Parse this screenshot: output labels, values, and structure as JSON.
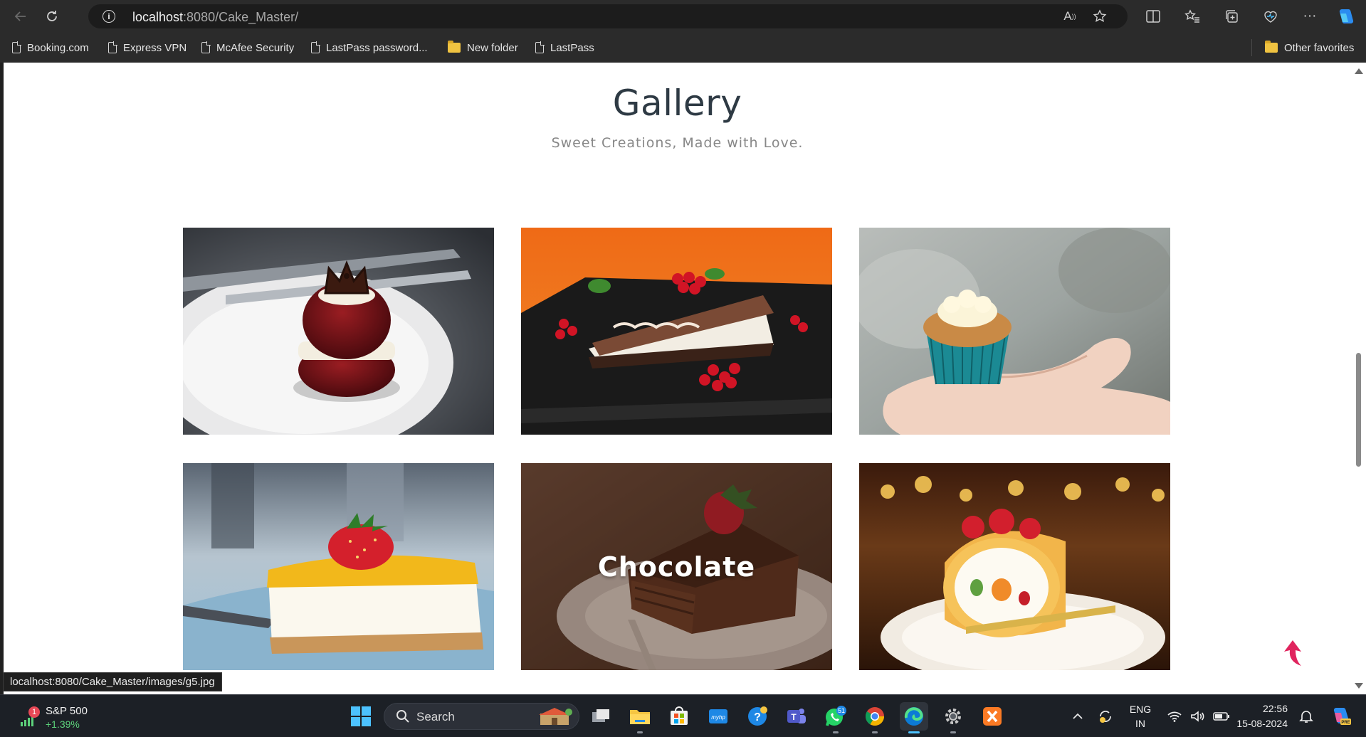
{
  "browser": {
    "url_host": "localhost",
    "url_rest": ":8080/Cake_Master/",
    "bookmarks": [
      {
        "label": "Booking.com",
        "icon": "page-icon"
      },
      {
        "label": "Express VPN",
        "icon": "page-icon"
      },
      {
        "label": "McAfee Security",
        "icon": "page-icon"
      },
      {
        "label": "LastPass password...",
        "icon": "page-icon"
      },
      {
        "label": "New folder",
        "icon": "folder-icon"
      },
      {
        "label": "LastPass",
        "icon": "page-icon"
      }
    ],
    "other_favorites": "Other favorites",
    "status_url": "localhost:8080/Cake_Master/images/g5.jpg"
  },
  "page": {
    "title": "Gallery",
    "subtitle": "Sweet Creations, Made with Love.",
    "gallery": [
      {
        "name": "red-velvet-crown-cake",
        "caption": ""
      },
      {
        "name": "berry-cheesecake-slice",
        "caption": ""
      },
      {
        "name": "cupcake-in-hand",
        "caption": ""
      },
      {
        "name": "strawberry-cheesecake",
        "caption": ""
      },
      {
        "name": "chocolate-cake-slice",
        "caption": "Chocolate"
      },
      {
        "name": "strawberry-swiss-roll",
        "caption": ""
      }
    ],
    "hovered_index": 4
  },
  "taskbar": {
    "stock_name": "S&P 500",
    "stock_change": "+1.39%",
    "stock_badge": "1",
    "search_label": "Search",
    "whatsapp_badge": "51",
    "language_line1": "ENG",
    "language_line2": "IN",
    "time": "22:56",
    "date": "15-08-2024"
  },
  "colors": {
    "chrome_bg": "#2b2b2b",
    "taskbar_bg": "#1c2026",
    "title_color": "#2e3a44",
    "subtitle_color": "#888888",
    "back_to_top": "#e0245e"
  }
}
